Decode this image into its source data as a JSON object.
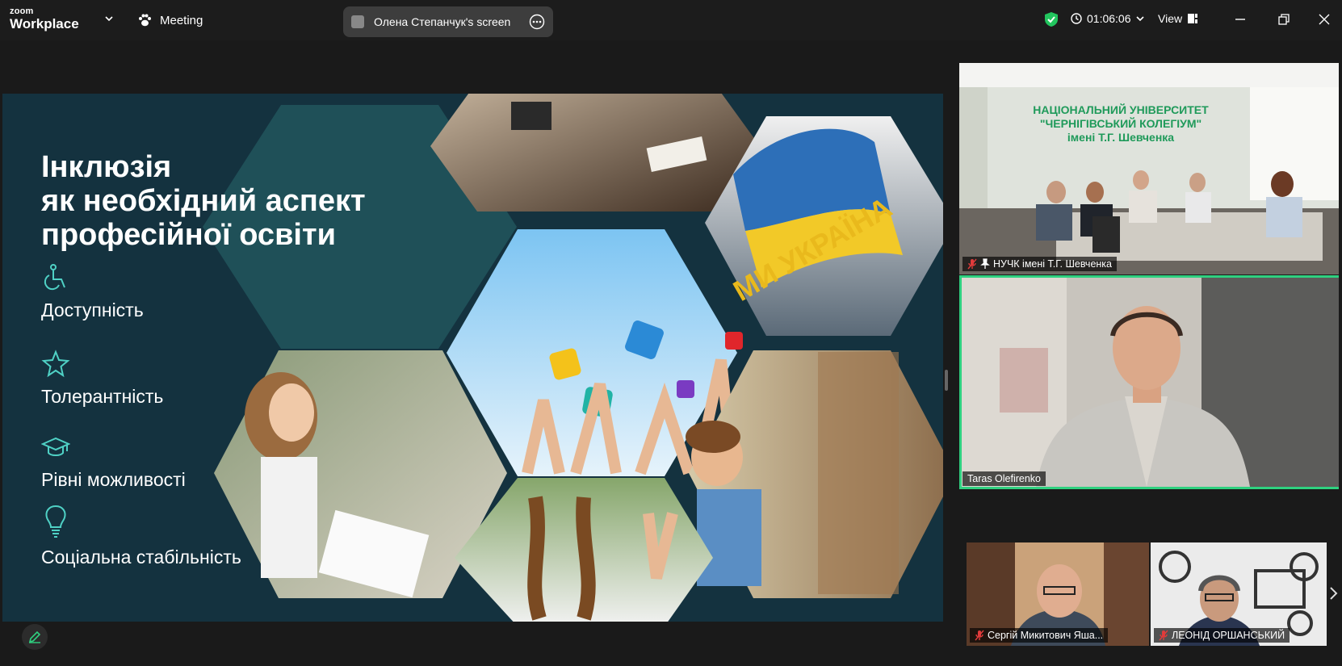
{
  "app": {
    "brand_top": "zoom",
    "brand_bottom": "Workplace",
    "meeting_label": "Meeting"
  },
  "share": {
    "label": "Олена Степанчук's screen"
  },
  "status": {
    "timer": "01:06:06",
    "view_label": "View"
  },
  "slide": {
    "title_lines": [
      "Інклюзія",
      "як необхідний аспект",
      "професійної освіти"
    ],
    "features": [
      {
        "icon": "wheelchair-icon",
        "label": "Доступність"
      },
      {
        "icon": "star-icon",
        "label": "Толерантність"
      },
      {
        "icon": "graduation-cap-icon",
        "label": "Рівні можливості"
      },
      {
        "icon": "lightbulb-icon",
        "label": "Соціальна стабільність"
      }
    ],
    "flag_text": "МИ УКРАЇНА"
  },
  "participants": {
    "room": {
      "name": "НУЧК імені Т.Г. Шевченка",
      "banner": [
        "НАЦІОНАЛЬНИЙ УНІВЕРСИТЕТ",
        "\"ЧЕРНІГІВСЬКИЙ КОЛЕГІУМ\"",
        "імені Т.Г. Шевченка"
      ]
    },
    "speaker": {
      "name": "Taras Olefirenko"
    },
    "thumb1": {
      "name": "Сергій Микитович Яша..."
    },
    "thumb2": {
      "name": "ЛЕОНІД ОРШАНСЬКИЙ"
    }
  },
  "colors": {
    "slide_bg": "#14323f",
    "hex_teal": "#1f5058",
    "active_speaker_border": "#2fd180",
    "shield_green": "#22c55e",
    "muted_red": "#e23b3b"
  }
}
